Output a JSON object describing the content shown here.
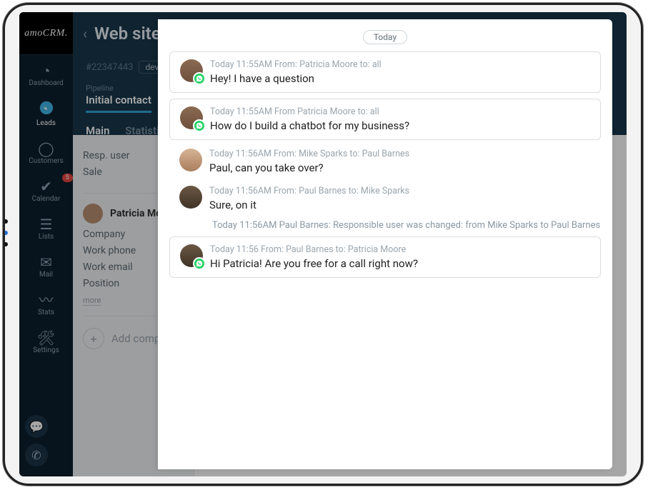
{
  "logo": "amoCRM.",
  "sidebar": {
    "items": [
      {
        "label": "Dashboard"
      },
      {
        "label": "Leads"
      },
      {
        "label": "Customers"
      },
      {
        "label": "Calendar",
        "badge": "5"
      },
      {
        "label": "Lists"
      },
      {
        "label": "Mail"
      },
      {
        "label": "Stats"
      },
      {
        "label": "Settings"
      }
    ]
  },
  "header": {
    "title": "Web site development"
  },
  "lead": {
    "id_label": "#22347443",
    "tag": "development",
    "pipeline_label": "Pipeline",
    "stage": "Initial contact",
    "tabs": [
      {
        "label": "Main"
      },
      {
        "label": "Statistics"
      }
    ]
  },
  "details": {
    "resp_user": "Resp. user",
    "sale": "Sale",
    "contact_name": "Patricia Moore",
    "fields": [
      "Company",
      "Work phone",
      "Work email",
      "Position"
    ],
    "more": "more",
    "add_company": "Add company"
  },
  "chat": {
    "separator": "Today",
    "messages": [
      {
        "kind": "card",
        "avatar": "patricia",
        "wa": true,
        "meta": "Today 11:55AM From: Patricia Moore to: all",
        "body": "Hey! I have a question"
      },
      {
        "kind": "card",
        "avatar": "patricia",
        "wa": true,
        "meta": "Today 11:55AM From Patricia Moore to: all",
        "body": "How do I build a chatbot for my business?"
      },
      {
        "kind": "plain",
        "avatar": "mike",
        "wa": false,
        "meta": "Today 11:56AM From: Mike Sparks to: Paul Barnes",
        "body": "Paul, can you take over?"
      },
      {
        "kind": "plain",
        "avatar": "paul",
        "wa": false,
        "meta": "Today 11:56AM From: Paul Barnes to: Mike Sparks",
        "body": "Sure, on it"
      },
      {
        "kind": "sys",
        "body": "Today 11:56AM Paul Barnes: Responsible user was changed: from Mike Sparks to Paul Barnes"
      },
      {
        "kind": "card",
        "avatar": "paul",
        "wa": true,
        "meta": "Today 11:56 From: Paul Barnes to: Patricia Moore",
        "body": "Hi Patricia! Are you free for a call right now?"
      }
    ]
  }
}
